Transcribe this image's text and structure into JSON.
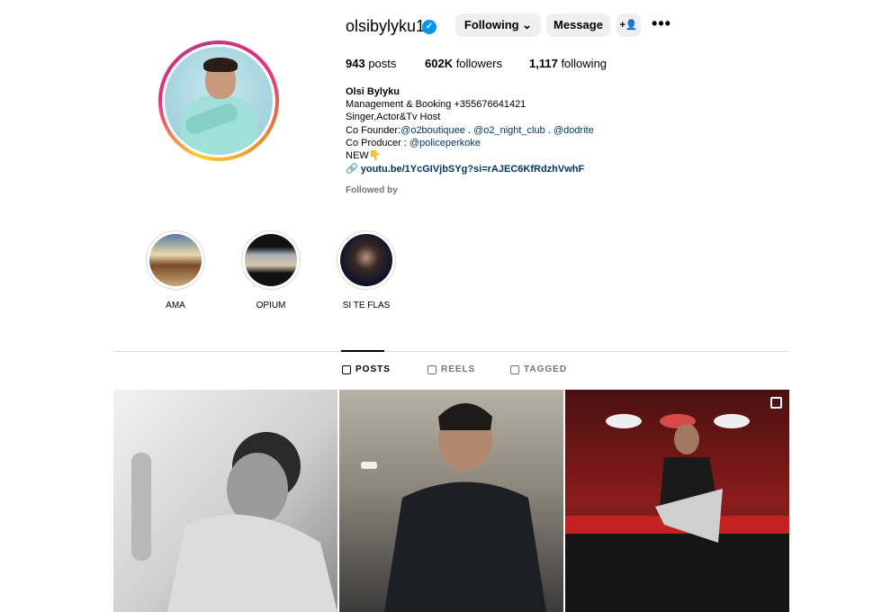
{
  "profile": {
    "username": "olsibylyku1",
    "verified_glyph": "✓",
    "buttons": {
      "following": "Following ⌄",
      "message": "Message",
      "add_user_glyph": "+👤"
    },
    "more_glyph": "•••",
    "stats": {
      "posts_count": "943",
      "posts_label": " posts",
      "followers_count": "602K",
      "followers_label": " followers",
      "following_count": "1,117",
      "following_label": " following"
    },
    "bio": {
      "name": "Olsi Bylyku",
      "line1": "Management & Booking +355676641421",
      "line2": "Singer,Actor&Tv Host",
      "line3_prefix": "Co Founder:",
      "line3_mention1": "@o2boutiquee",
      "line3_sep1": " . ",
      "line3_mention2": "@o2_night_club",
      "line3_sep2": " . ",
      "line3_mention3": "@dodrite",
      "line4_prefix": "Co Producer : ",
      "line4_mention": "@policeperkoke",
      "line5": "NEW👇",
      "link": "🔗 youtu.be/1YcGIVjbSYg?si=rAJEC6KfRdzhVwhF"
    },
    "followed_by": "Followed by"
  },
  "highlights": [
    {
      "label": "AMA"
    },
    {
      "label": "OPIUM"
    },
    {
      "label": "SI TE FLAS"
    }
  ],
  "tabs": [
    {
      "label": "POSTS",
      "active": true
    },
    {
      "label": "REELS",
      "active": false
    },
    {
      "label": "TAGGED",
      "active": false
    }
  ],
  "colors": {
    "link": "#00376b",
    "verified": "#0095f6",
    "muted": "#737373"
  }
}
